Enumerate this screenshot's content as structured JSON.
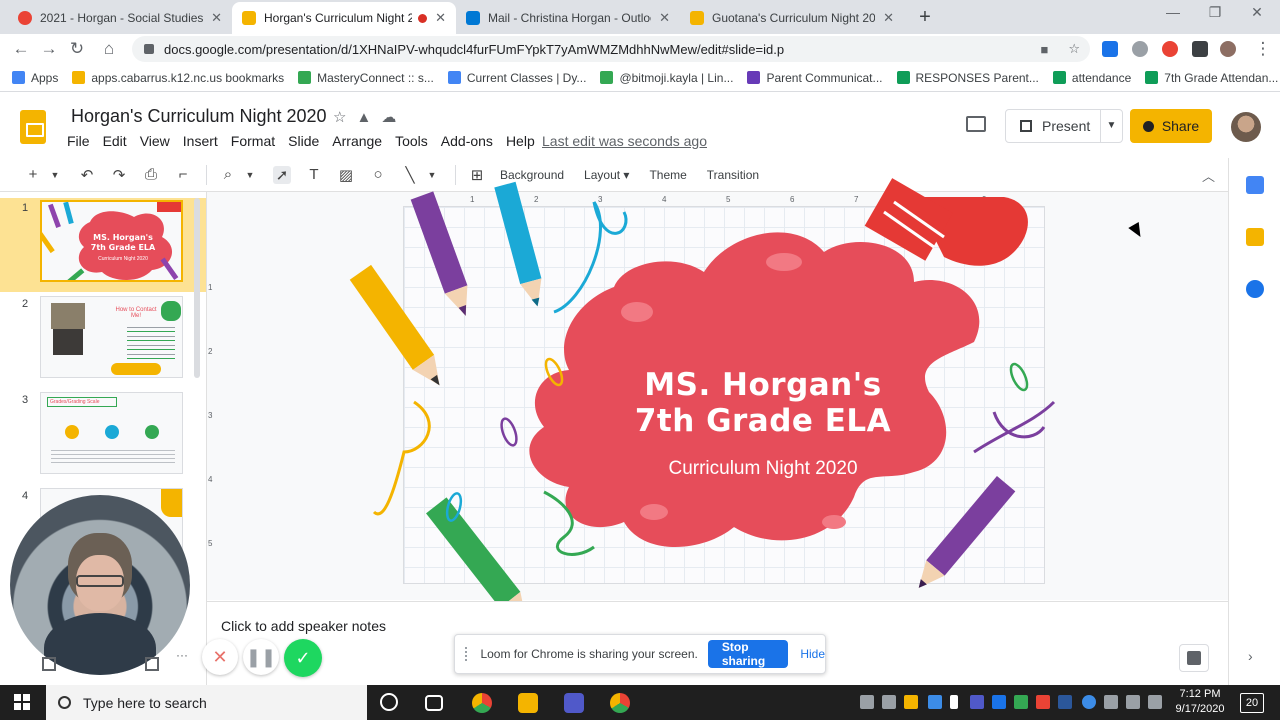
{
  "browser": {
    "tabs": [
      {
        "title": "2021 - Horgan - Social Studies G",
        "favicon_color": "#ea4335"
      },
      {
        "title": "Horgan's Curriculum Night 2",
        "favicon_color": "#f4b400"
      },
      {
        "title": "Mail - Christina Horgan - Outlool",
        "favicon_color": "#0078d4"
      },
      {
        "title": "Guotana's Curriculum Night 2020",
        "favicon_color": "#f4b400"
      }
    ],
    "url": "docs.google.com/presentation/d/1XHNaIPV-whqudcl4furFUmFYpkT7yAmWMZMdhhNwMew/edit#slide=id.p",
    "bookmarks": [
      {
        "label": "Apps",
        "color": "#4285f4"
      },
      {
        "label": "apps.cabarrus.k12.nc.us bookmarks",
        "color": "#f4b400"
      },
      {
        "label": "MasteryConnect :: s...",
        "color": "#34a853"
      },
      {
        "label": "Current Classes | Dy...",
        "color": "#4285f4"
      },
      {
        "label": "@bitmoji.kayla | Lin...",
        "color": "#34a853"
      },
      {
        "label": "Parent Communicat...",
        "color": "#673ab7"
      },
      {
        "label": "RESPONSES Parent...",
        "color": "#0f9d58"
      },
      {
        "label": "attendance",
        "color": "#0f9d58"
      },
      {
        "label": "7th Grade Attendan...",
        "color": "#0f9d58"
      }
    ]
  },
  "app": {
    "title": "Horgan's Curriculum Night 2020",
    "menu": [
      "File",
      "Edit",
      "View",
      "Insert",
      "Format",
      "Slide",
      "Arrange",
      "Tools",
      "Add-ons",
      "Help"
    ],
    "last_edit": "Last edit was seconds ago",
    "present_label": "Present",
    "share_label": "Share",
    "brand_color": "#f4b400"
  },
  "toolbar": {
    "background": "Background",
    "layout": "Layout",
    "theme": "Theme",
    "transition": "Transition"
  },
  "filmstrip": {
    "numbers": [
      "1",
      "2",
      "3",
      "4"
    ],
    "thumb2_heading": "How to Contact Me!",
    "thumb3_heading": "Grades/Grading Scale"
  },
  "slide": {
    "title_line1": "MS. Horgan's",
    "title_line2": "7th Grade ELA",
    "subtitle": "Curriculum Night 2020",
    "blob_color": "#e64d5a"
  },
  "ruler_h": [
    "1",
    "2",
    "3",
    "4",
    "5",
    "6",
    "7",
    "8",
    "9"
  ],
  "ruler_v": [
    "1",
    "2",
    "3",
    "4",
    "5"
  ],
  "notes": {
    "placeholder": "Click to add speaker notes"
  },
  "loom": {
    "message": "Loom for Chrome is sharing your screen.",
    "stop": "Stop sharing",
    "hide": "Hide"
  },
  "taskbar": {
    "search_placeholder": "Type here to search",
    "time": "7:12 PM",
    "date": "9/17/2020",
    "notification_count": "20"
  }
}
